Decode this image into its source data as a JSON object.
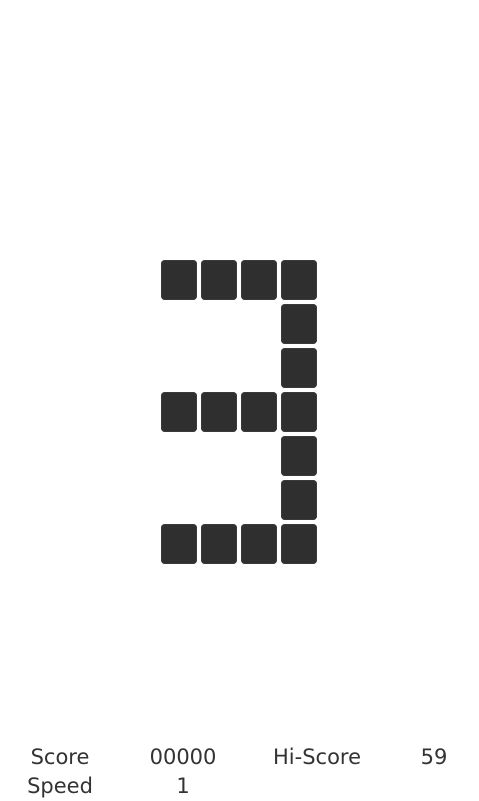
{
  "game": {
    "countdown_digit": 3,
    "block_color": "#2f2f2f",
    "background_color": "#ffffff"
  },
  "stats": {
    "score_label": "Score",
    "score_value": "00000",
    "hiscore_label": "Hi-Score",
    "hiscore_value": "59",
    "speed_label": "Speed",
    "speed_value": "1"
  }
}
